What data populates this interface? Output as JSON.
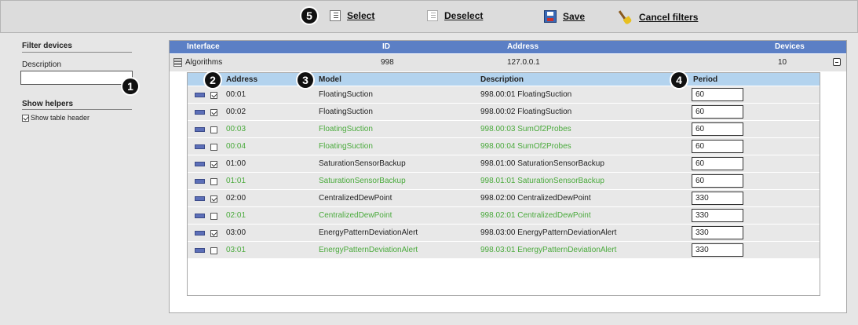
{
  "toolbar": {
    "select_label": "Select",
    "deselect_label": "Deselect",
    "save_label": "Save",
    "cancel_filters_label": "Cancel filters"
  },
  "badges": [
    "1",
    "2",
    "3",
    "4",
    "5"
  ],
  "sidebar": {
    "filter_title": "Filter devices",
    "description_label": "Description",
    "description_value": "",
    "helpers_title": "Show helpers",
    "show_table_header_label": "Show table header",
    "show_table_header_checked": true
  },
  "table": {
    "headers": {
      "interface": "Interface",
      "id": "ID",
      "address": "Address",
      "devices": "Devices"
    },
    "group": {
      "interface": "Algorithms",
      "id": "998",
      "address": "127.0.0.1",
      "devices": "10"
    },
    "inner_headers": {
      "address": "Address",
      "model": "Model",
      "description": "Description",
      "period": "Period"
    },
    "rows": [
      {
        "checked": true,
        "active": true,
        "address": "00:01",
        "model": "FloatingSuction",
        "description": "998.00:01 FloatingSuction",
        "period": "60"
      },
      {
        "checked": true,
        "active": true,
        "address": "00:02",
        "model": "FloatingSuction",
        "description": "998.00:02 FloatingSuction",
        "period": "60"
      },
      {
        "checked": false,
        "active": false,
        "address": "00:03",
        "model": "FloatingSuction",
        "description": "998.00:03 SumOf2Probes",
        "period": "60"
      },
      {
        "checked": false,
        "active": false,
        "address": "00:04",
        "model": "FloatingSuction",
        "description": "998.00:04 SumOf2Probes",
        "period": "60"
      },
      {
        "checked": true,
        "active": true,
        "address": "01:00",
        "model": "SaturationSensorBackup",
        "description": "998.01:00 SaturationSensorBackup",
        "period": "60"
      },
      {
        "checked": false,
        "active": false,
        "address": "01:01",
        "model": "SaturationSensorBackup",
        "description": "998.01:01 SaturationSensorBackup",
        "period": "60"
      },
      {
        "checked": true,
        "active": true,
        "address": "02:00",
        "model": "CentralizedDewPoint",
        "description": "998.02:00 CentralizedDewPoint",
        "period": "330"
      },
      {
        "checked": false,
        "active": false,
        "address": "02:01",
        "model": "CentralizedDewPoint",
        "description": "998.02:01 CentralizedDewPoint",
        "period": "330"
      },
      {
        "checked": true,
        "active": true,
        "address": "03:00",
        "model": "EnergyPatternDeviationAlert",
        "description": "998.03:00 EnergyPatternDeviationAlert",
        "period": "330"
      },
      {
        "checked": false,
        "active": false,
        "address": "03:01",
        "model": "EnergyPatternDeviationAlert",
        "description": "998.03:01 EnergyPatternDeviationAlert",
        "period": "330"
      }
    ]
  },
  "colors": {
    "header_blue": "#5b7fc5",
    "subheader_blue": "#b3d3ee",
    "inactive_green": "#4aaa3c",
    "device_icon": "#5c6fb8"
  },
  "icons": [
    "list-icon",
    "save-disk-icon",
    "broom-icon",
    "device-icon",
    "collapse-icon",
    "checkbox-icon"
  ]
}
